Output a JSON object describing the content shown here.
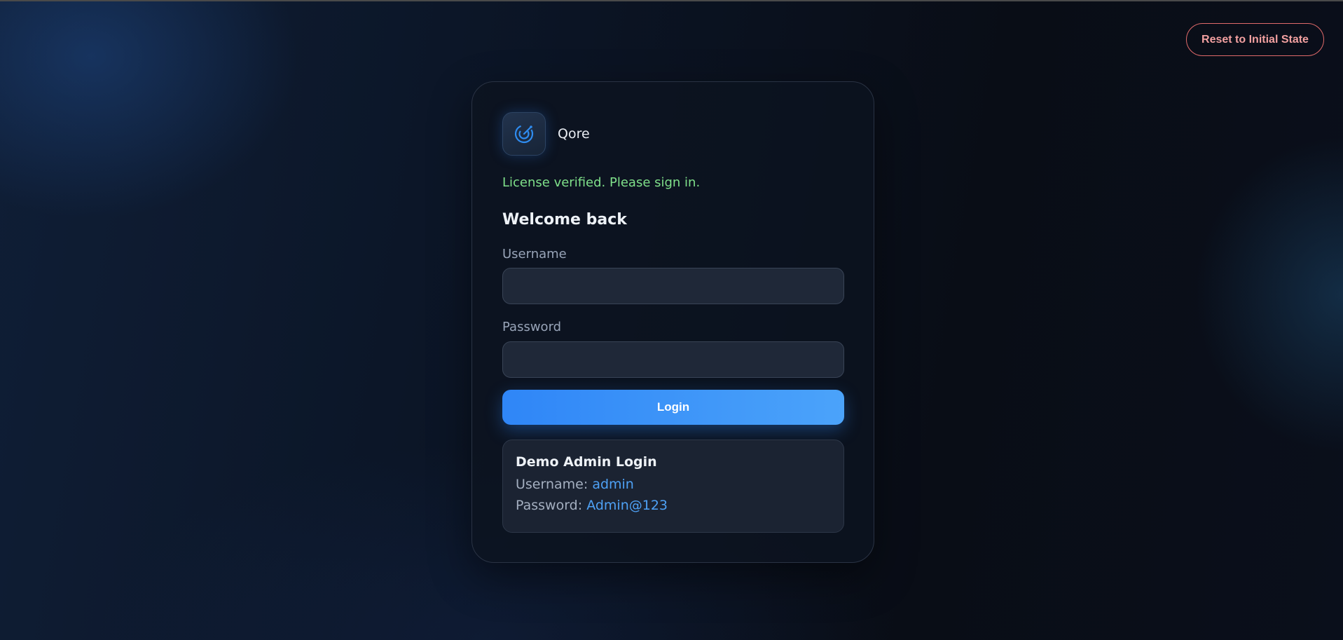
{
  "header": {
    "reset_label": "Reset to Initial State"
  },
  "brand": {
    "name": "Qore",
    "icon": "radar-icon"
  },
  "status": {
    "message": "License verified. Please sign in."
  },
  "form": {
    "heading": "Welcome back",
    "username_label": "Username",
    "username_value": "",
    "password_label": "Password",
    "password_value": "",
    "login_label": "Login"
  },
  "demo": {
    "title": "Demo Admin Login",
    "username_label": "Username:",
    "username_value": "admin",
    "password_label": "Password:",
    "password_value": "Admin@123"
  },
  "colors": {
    "accent": "#2f86f7",
    "success": "#7fe08a",
    "danger": "#e06a6a",
    "link": "#4ea1f5"
  }
}
